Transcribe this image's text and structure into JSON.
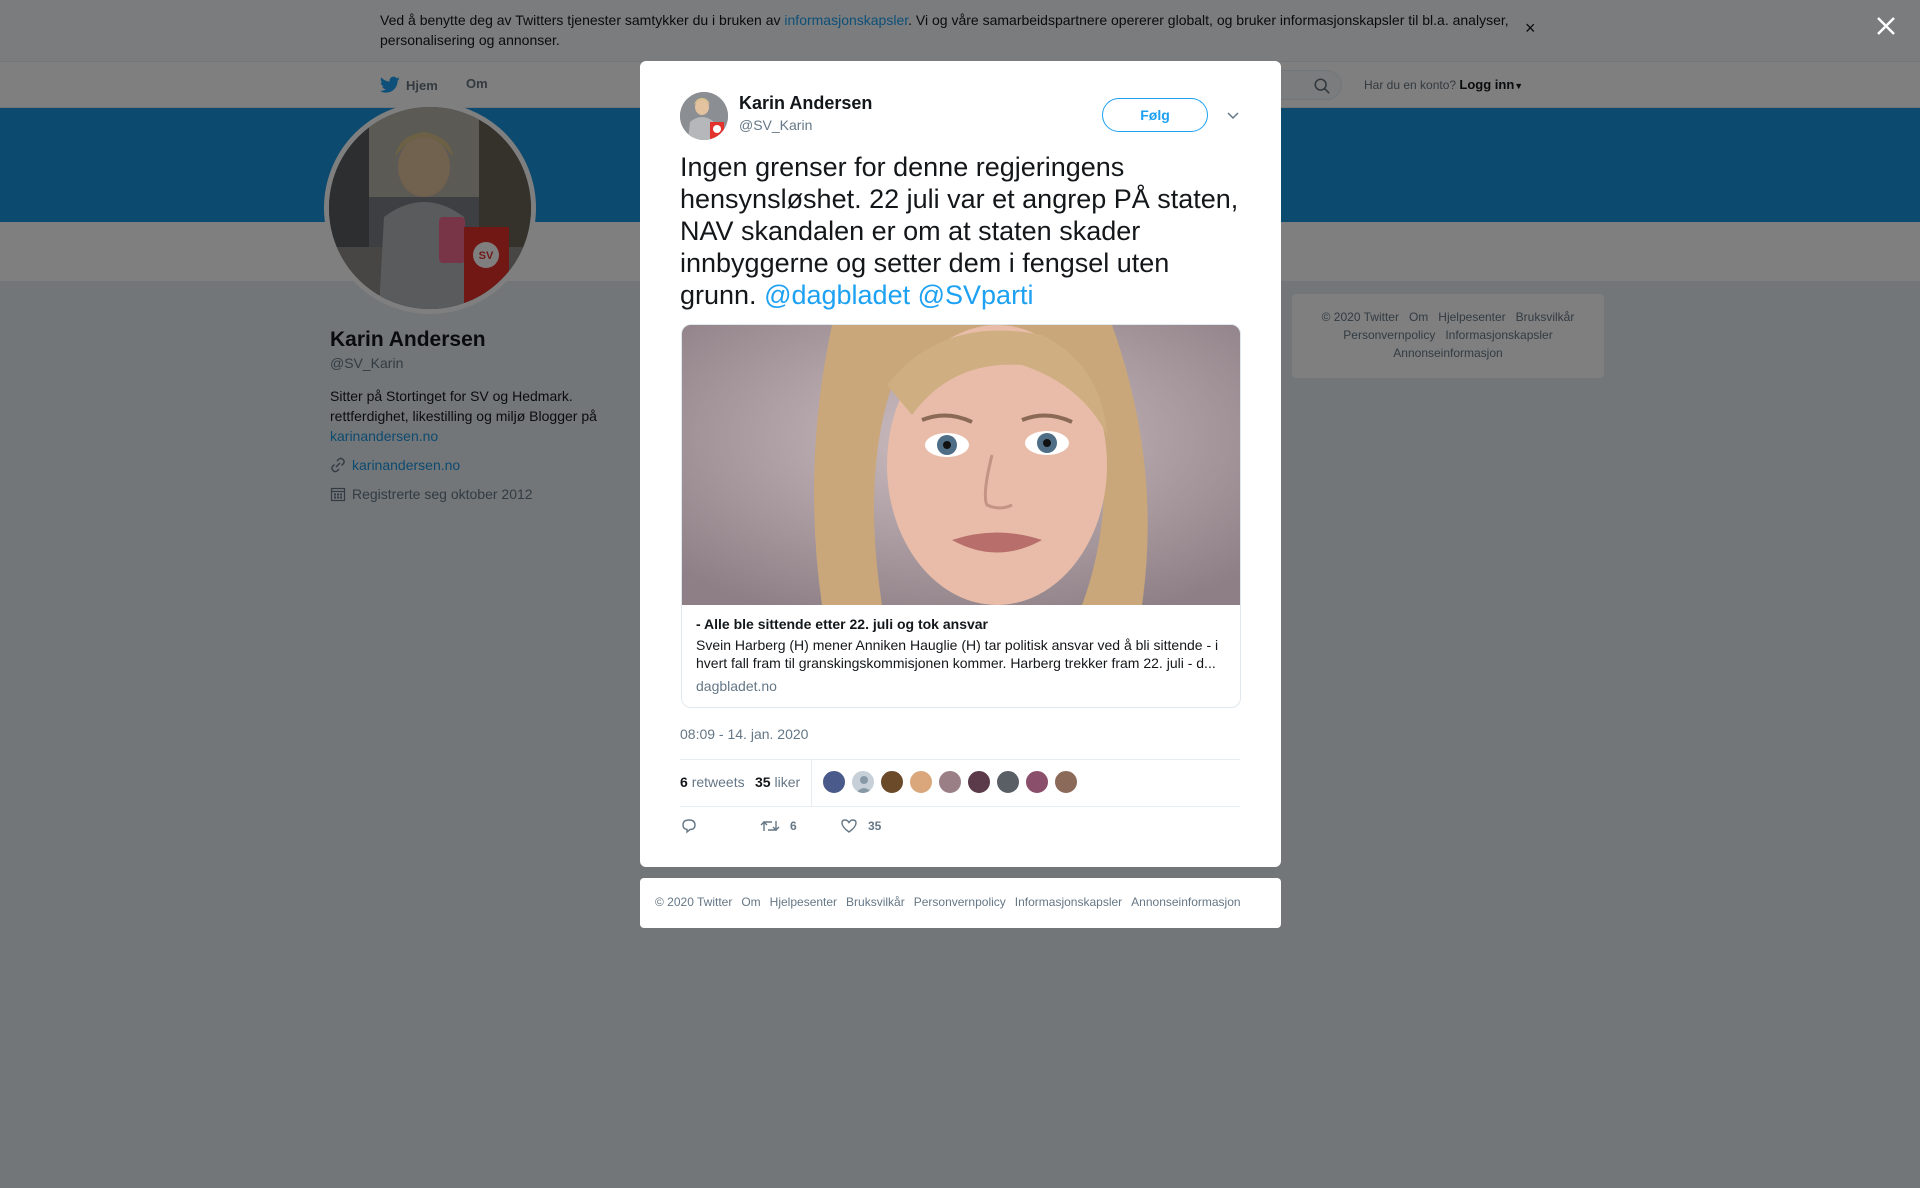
{
  "cookie": {
    "text_before": "Ved å benytte deg av Twitters tjenester samtykker du i bruken av ",
    "link": "informasjonskapsler",
    "text_after": ". Vi og våre samarbeidspartnere opererer globalt, og bruker informasjonskapsler til bl.a. analyser, personalisering og annonser.",
    "close": "×"
  },
  "nav": {
    "home": "Hjem",
    "about": "Om",
    "login_prompt": "Har du en konto?",
    "login": "Logg inn"
  },
  "profile": {
    "name": "Karin Andersen",
    "handle": "@SV_Karin",
    "bio": "Sitter på Stortinget for SV og Hedmark. rettferdighet, likestilling og miljø Blogger på ",
    "bio_link": "karinandersen.no",
    "website": "karinandersen.no",
    "joined": "Registrerte seg oktober 2012"
  },
  "side_footer": {
    "items": [
      "© 2020 Twitter",
      "Om",
      "Hjelpesenter",
      "Bruksvilkår",
      "Personvernpolicy",
      "Informasjonskapsler",
      "Annonseinformasjon"
    ]
  },
  "tweet": {
    "author_name": "Karin Andersen",
    "author_handle": "@SV_Karin",
    "follow_label": "Følg",
    "text": "Ingen grenser for denne regjeringens hensynsløshet. 22 juli var et angrep PÅ staten, NAV skandalen er om at staten skader innbyggerne og setter dem i fengsel uten grunn. ",
    "mention1": "@dagbladet",
    "mention2": "@SVparti",
    "card": {
      "title": "- Alle ble sittende etter 22. juli og tok ansvar",
      "description": "Svein Harberg (H) mener Anniken Hauglie (H) tar politisk ansvar ved å bli sittende - i hvert fall fram til granskingskommisjonen kommer. Harberg trekker fram 22. juli - d...",
      "domain": "dagbladet.no"
    },
    "timestamp": "08:09 - 14. jan. 2020",
    "retweets_count": "6",
    "retweets_label": "retweets",
    "likes_count": "35",
    "likes_label": "liker",
    "action_retweets": "6",
    "action_likes": "35"
  },
  "modal_footer": {
    "items": [
      "© 2020 Twitter",
      "Om",
      "Hjelpesenter",
      "Bruksvilkår",
      "Personvernpolicy",
      "Informasjonskapsler",
      "Annonseinformasjon"
    ]
  },
  "colors": {
    "accent": "#1da1f2",
    "banner": "#1b95e0",
    "text": "#14171a",
    "muted": "#657786"
  }
}
